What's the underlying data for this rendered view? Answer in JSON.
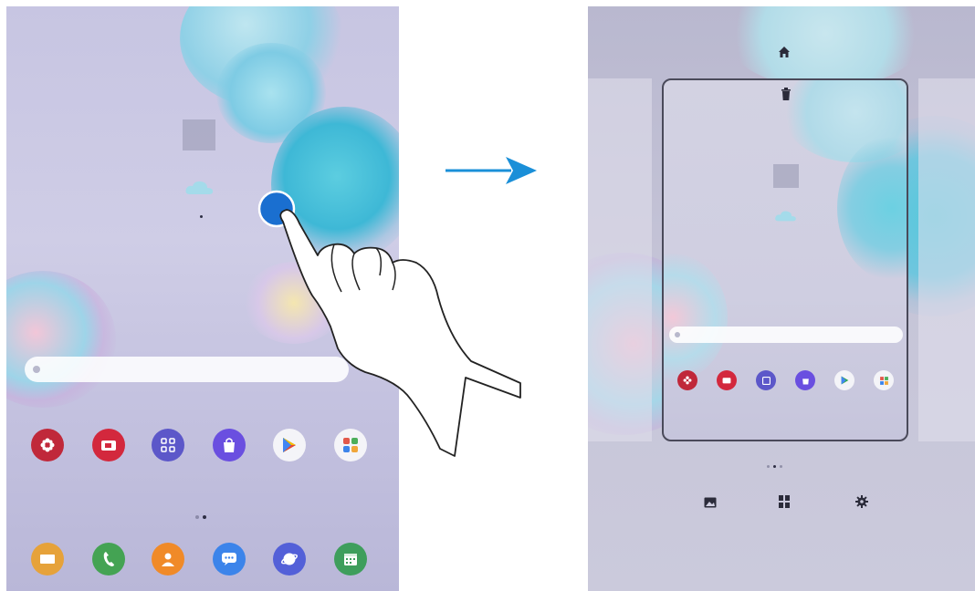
{
  "left_screen": {
    "search_bar": {
      "placeholder": "",
      "action": ""
    },
    "apps_row1": [
      {
        "icon": "flower-icon",
        "label": "",
        "color": "#c0283a"
      },
      {
        "icon": "tv-icon",
        "label": "",
        "color": "#d3283d"
      },
      {
        "icon": "grid-icon",
        "label": "",
        "color": "#5c57c9"
      },
      {
        "icon": "bag-icon",
        "label": "",
        "color": "#6a4fe0"
      },
      {
        "icon": "play-store-icon",
        "label": "",
        "color": "#f4f4f8"
      },
      {
        "icon": "folder-icon",
        "label": "",
        "color": "#f4f4f8"
      }
    ],
    "apps_row2": [
      {
        "icon": "email-icon",
        "label": "",
        "color": "#e6a23a"
      },
      {
        "icon": "phone-icon",
        "label": "",
        "color": "#44a353"
      },
      {
        "icon": "contacts-icon",
        "label": "",
        "color": "#f08a28"
      },
      {
        "icon": "messages-icon",
        "label": "",
        "color": "#3c84ea"
      },
      {
        "icon": "browser-icon",
        "label": "",
        "color": "#5360d8"
      },
      {
        "icon": "calendar-icon",
        "label": "",
        "color": "#3e9e5c"
      }
    ]
  },
  "right_screen": {
    "top_icons": [
      "home-icon",
      "trash-icon"
    ],
    "apps": [
      {
        "icon": "flower-icon",
        "color": "#c0283a"
      },
      {
        "icon": "tv-icon",
        "color": "#d3283d"
      },
      {
        "icon": "grid-icon",
        "color": "#5c57c9"
      },
      {
        "icon": "bag-icon",
        "color": "#6a4fe0"
      },
      {
        "icon": "play-store-icon",
        "color": "#f4f4f8"
      },
      {
        "icon": "folder-icon",
        "color": "#f4f4f8"
      }
    ],
    "bottom_options": [
      {
        "icon": "wallpaper-icon",
        "label": ""
      },
      {
        "icon": "widgets-icon",
        "label": ""
      },
      {
        "icon": "settings-gear-icon",
        "label": ""
      }
    ]
  },
  "colors": {
    "arrow": "#1a8fd8",
    "touch": "#1a6fd0"
  }
}
